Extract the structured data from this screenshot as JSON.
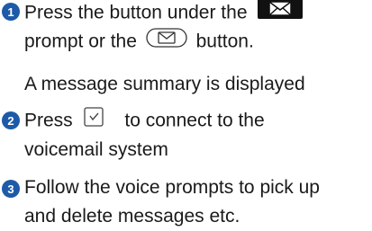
{
  "steps": [
    {
      "number": "1",
      "line1_pre": "Press the button under the",
      "line2_a": "prompt or the",
      "line2_b": "button.",
      "note": "A message summary is displayed",
      "icons": [
        "envelope-prompt-icon",
        "message-button-icon"
      ]
    },
    {
      "number": "2",
      "line1_pre": "Press",
      "line1_post": "to connect to the",
      "line2": "voicemail system",
      "icons": [
        "handset-button-icon"
      ]
    },
    {
      "number": "3",
      "line1": "Follow the voice prompts to pick up",
      "line2": "and delete messages etc."
    }
  ],
  "colors": {
    "badge": "#1d5aa8",
    "text": "#1a1a1a"
  }
}
